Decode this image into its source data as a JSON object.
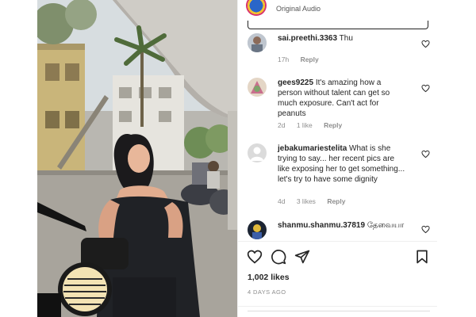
{
  "post": {
    "audio_label": "Original Audio",
    "likes": "1,002 likes",
    "date": "4 DAYS AGO"
  },
  "comments": [
    {
      "username": "sai.preethi.3363",
      "text": "Thu",
      "time": "17h",
      "likes": "",
      "reply": "Reply"
    },
    {
      "username": "gees9225",
      "text": "It's amazing how a person without talent can get so much exposure. Can't act for peanuts",
      "time": "2d",
      "likes": "1 like",
      "reply": "Reply"
    },
    {
      "username": "jebakumariestelita",
      "text": "What is she trying to say... her recent pics are like exposing her to get something... let's try to have some dignity",
      "time": "4d",
      "likes": "3 likes",
      "reply": "Reply"
    },
    {
      "username": "shanmu.shanmu.37819",
      "text": "தேவையா",
      "time": "",
      "likes": "",
      "reply": ""
    }
  ],
  "icons": {
    "like": "heart-icon",
    "comment": "comment-icon",
    "share": "send-icon",
    "save": "bookmark-icon",
    "comment_like": "heart-outline-icon",
    "audio": "speaker-icon"
  },
  "colors": {
    "text": "#262626",
    "muted": "#8e8e8e",
    "divider": "#efefef"
  }
}
